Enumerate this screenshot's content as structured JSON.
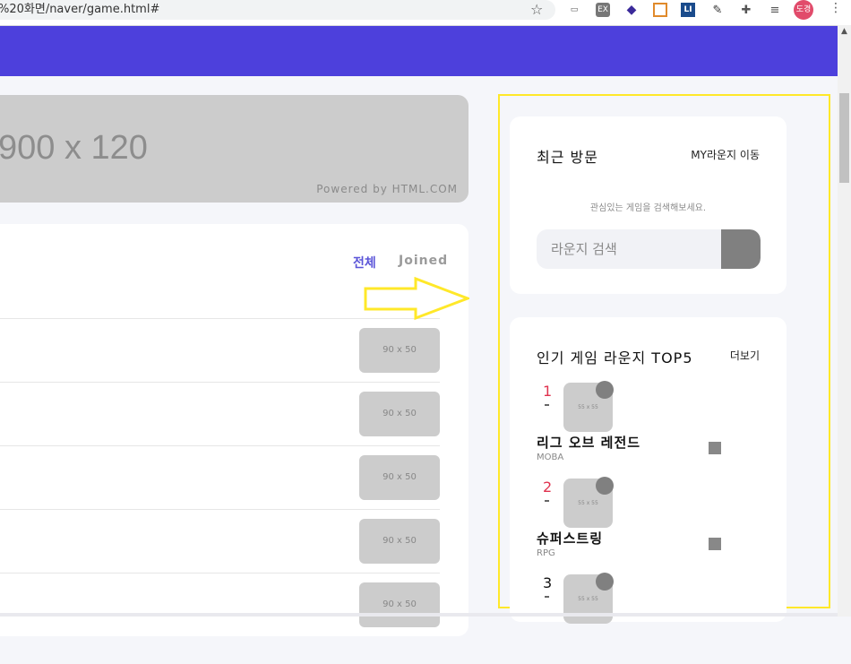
{
  "browser": {
    "url": "%20화면/naver/game.html#",
    "avatar_label": "도경"
  },
  "colors": {
    "header": "#4d40dc",
    "accent_tab": "#5b55d8",
    "highlight_outline": "#ffe829",
    "rank_red": "#e0334f"
  },
  "banner": {
    "size_label": "900 x 120",
    "powered": "Powered by HTML.COM"
  },
  "list": {
    "tabs": [
      "전체",
      "Joined"
    ],
    "rows": [
      {
        "thumb": "90 x 50"
      },
      {
        "thumb": "90 x 50"
      },
      {
        "thumb": "90 x 50"
      },
      {
        "thumb": "90 x 50"
      },
      {
        "thumb": "90 x 50"
      }
    ]
  },
  "recent": {
    "title": "최근 방문",
    "link": "MY라운지 이동",
    "hint": "관심있는 게임을 검색해보세요.",
    "search_placeholder": "라운지 검색"
  },
  "popular": {
    "title": "인기 게임 라운지 TOP5",
    "more": "더보기",
    "items": [
      {
        "rank": "1",
        "thumb": "55 x 55",
        "name": "리그 오브 레전드",
        "category": "MOBA"
      },
      {
        "rank": "2",
        "thumb": "55 x 55",
        "name": "슈퍼스트링",
        "category": "RPG"
      },
      {
        "rank": "3",
        "thumb": "55 x 55",
        "name": "",
        "category": ""
      }
    ]
  }
}
